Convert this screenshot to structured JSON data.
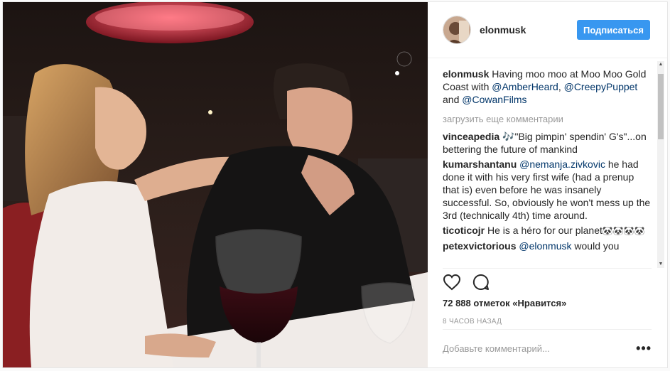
{
  "post": {
    "username": "elonmusk",
    "follow_label": "Подписаться",
    "caption": {
      "user": "elonmusk",
      "text_1": " Having moo moo at Moo Moo Gold Coast with ",
      "mention_1": "@AmberHeard",
      "text_2": ", ",
      "mention_2": "@CreepyPuppet",
      "text_3": " and ",
      "mention_3": "@CowanFilms"
    },
    "load_more_label": "загрузить еще комментарии",
    "comments": [
      {
        "user": "vinceapedia",
        "text": " 🎶\"Big pimpin' spendin' G's\"...on bettering the future of mankind"
      },
      {
        "user": "kumarshantanu",
        "mention": "@nemanja.zivkovic",
        "text": " he had done it with his very first wife (had a prenup that is) even before he was insanely successful. So, obviously he won't mess up the 3rd (technically 4th) time around."
      },
      {
        "user": "ticoticojr",
        "text": " He is a héro for our planet",
        "emoji": "🐼🐼🐼🐼"
      },
      {
        "user": "petexvictorious",
        "mention": "@elonmusk",
        "text": " would you"
      }
    ],
    "likes_label": "72 888 отметок «Нравится»",
    "time_label": "8 ЧАСОВ НАЗАД",
    "comment_placeholder": "Добавьте комментарий...",
    "more_label": "•••",
    "icons": {
      "like": "heart-icon",
      "comment": "comment-icon",
      "options": "more-options-icon"
    }
  }
}
